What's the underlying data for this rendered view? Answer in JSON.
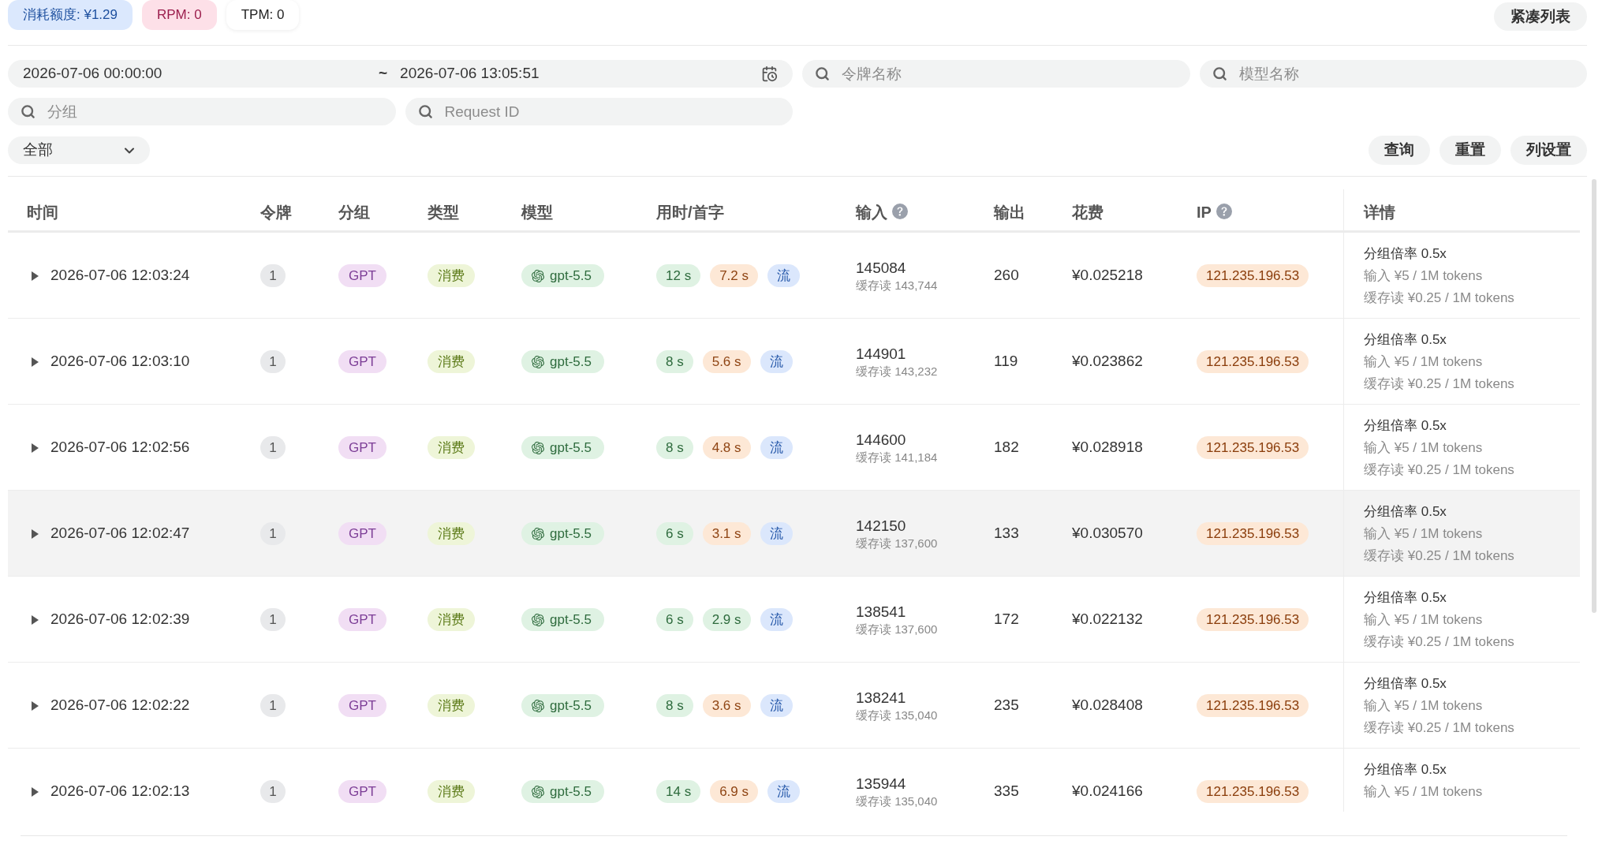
{
  "stats": [
    {
      "kind": "quota",
      "label": "消耗额度: ¥1.29"
    },
    {
      "kind": "rpm",
      "label": "RPM: 0"
    },
    {
      "kind": "tpm",
      "label": "TPM: 0"
    }
  ],
  "compact_button": "紧凑列表",
  "filters": {
    "date_range": {
      "start": "2026-07-06 00:00:00",
      "separator": "~",
      "end": "2026-07-06 13:05:51"
    },
    "token_name": {
      "placeholder": "令牌名称"
    },
    "model_name": {
      "placeholder": "模型名称"
    },
    "group": {
      "placeholder": "分组"
    },
    "request_id": {
      "placeholder": "Request ID"
    },
    "type_select": {
      "value": "全部"
    }
  },
  "actions": [
    "查询",
    "重置",
    "列设置"
  ],
  "table": {
    "columns": [
      {
        "label": "时间",
        "help": false
      },
      {
        "label": "令牌",
        "help": false
      },
      {
        "label": "分组",
        "help": false
      },
      {
        "label": "类型",
        "help": false
      },
      {
        "label": "模型",
        "help": false
      },
      {
        "label": "用时/首字",
        "help": false
      },
      {
        "label": "输入",
        "help": true
      },
      {
        "label": "输出",
        "help": false
      },
      {
        "label": "花费",
        "help": false
      },
      {
        "label": "IP",
        "help": true
      },
      {
        "label": "详情",
        "help": false
      }
    ],
    "rows": [
      {
        "time": "2026-07-06 12:03:24",
        "expanded": false,
        "hovered": false,
        "token": "1",
        "group": "GPT",
        "type": "消费",
        "model": "gpt-5.5",
        "duration": "12 s",
        "first_token": {
          "text": "7.2 s",
          "color": "#fde8d6"
        },
        "stream": "流",
        "input": "145084",
        "cache_read": "缓存读 143,744",
        "output": "260",
        "cost": "¥0.025218",
        "ip": "121.235.196.53",
        "details": [
          "分组倍率 0.5x",
          "输入 ¥5 / 1M tokens",
          "缓存读 ¥0.25 / 1M tokens"
        ]
      },
      {
        "time": "2026-07-06 12:03:10",
        "expanded": false,
        "hovered": false,
        "token": "1",
        "group": "GPT",
        "type": "消费",
        "model": "gpt-5.5",
        "duration": "8 s",
        "first_token": {
          "text": "5.6 s",
          "color": "#fde8d6"
        },
        "stream": "流",
        "input": "144901",
        "cache_read": "缓存读 143,232",
        "output": "119",
        "cost": "¥0.023862",
        "ip": "121.235.196.53",
        "details": [
          "分组倍率 0.5x",
          "输入 ¥5 / 1M tokens",
          "缓存读 ¥0.25 / 1M tokens"
        ]
      },
      {
        "time": "2026-07-06 12:02:56",
        "expanded": false,
        "hovered": false,
        "token": "1",
        "group": "GPT",
        "type": "消费",
        "model": "gpt-5.5",
        "duration": "8 s",
        "first_token": {
          "text": "4.8 s",
          "color": "#fde8d6"
        },
        "stream": "流",
        "input": "144600",
        "cache_read": "缓存读 141,184",
        "output": "182",
        "cost": "¥0.028918",
        "ip": "121.235.196.53",
        "details": [
          "分组倍率 0.5x",
          "输入 ¥5 / 1M tokens",
          "缓存读 ¥0.25 / 1M tokens"
        ]
      },
      {
        "time": "2026-07-06 12:02:47",
        "expanded": false,
        "hovered": true,
        "token": "1",
        "group": "GPT",
        "type": "消费",
        "model": "gpt-5.5",
        "duration": "6 s",
        "first_token": {
          "text": "3.1 s",
          "color": "#fde8d6"
        },
        "stream": "流",
        "input": "142150",
        "cache_read": "缓存读 137,600",
        "output": "133",
        "cost": "¥0.030570",
        "ip": "121.235.196.53",
        "details": [
          "分组倍率 0.5x",
          "输入 ¥5 / 1M tokens",
          "缓存读 ¥0.25 / 1M tokens"
        ]
      },
      {
        "time": "2026-07-06 12:02:39",
        "expanded": false,
        "hovered": false,
        "token": "1",
        "group": "GPT",
        "type": "消费",
        "model": "gpt-5.5",
        "duration": "6 s",
        "first_token": {
          "text": "2.9 s",
          "color": "#dff2e3"
        },
        "stream": "流",
        "input": "138541",
        "cache_read": "缓存读 137,600",
        "output": "172",
        "cost": "¥0.022132",
        "ip": "121.235.196.53",
        "details": [
          "分组倍率 0.5x",
          "输入 ¥5 / 1M tokens",
          "缓存读 ¥0.25 / 1M tokens"
        ]
      },
      {
        "time": "2026-07-06 12:02:22",
        "expanded": false,
        "hovered": false,
        "token": "1",
        "group": "GPT",
        "type": "消费",
        "model": "gpt-5.5",
        "duration": "8 s",
        "first_token": {
          "text": "3.6 s",
          "color": "#fde8d6"
        },
        "stream": "流",
        "input": "138241",
        "cache_read": "缓存读 135,040",
        "output": "235",
        "cost": "¥0.028408",
        "ip": "121.235.196.53",
        "details": [
          "分组倍率 0.5x",
          "输入 ¥5 / 1M tokens",
          "缓存读 ¥0.25 / 1M tokens"
        ]
      },
      {
        "time": "2026-07-06 12:02:13",
        "expanded": false,
        "hovered": false,
        "token": "1",
        "group": "GPT",
        "type": "消费",
        "model": "gpt-5.5",
        "duration": "14 s",
        "first_token": {
          "text": "6.9 s",
          "color": "#fde8d6"
        },
        "stream": "流",
        "input": "135944",
        "cache_read": "缓存读 135,040",
        "output": "335",
        "cost": "¥0.024166",
        "ip": "121.235.196.53",
        "details": [
          "分组倍率 0.5x",
          "输入 ¥5 / 1M tokens"
        ]
      }
    ]
  }
}
